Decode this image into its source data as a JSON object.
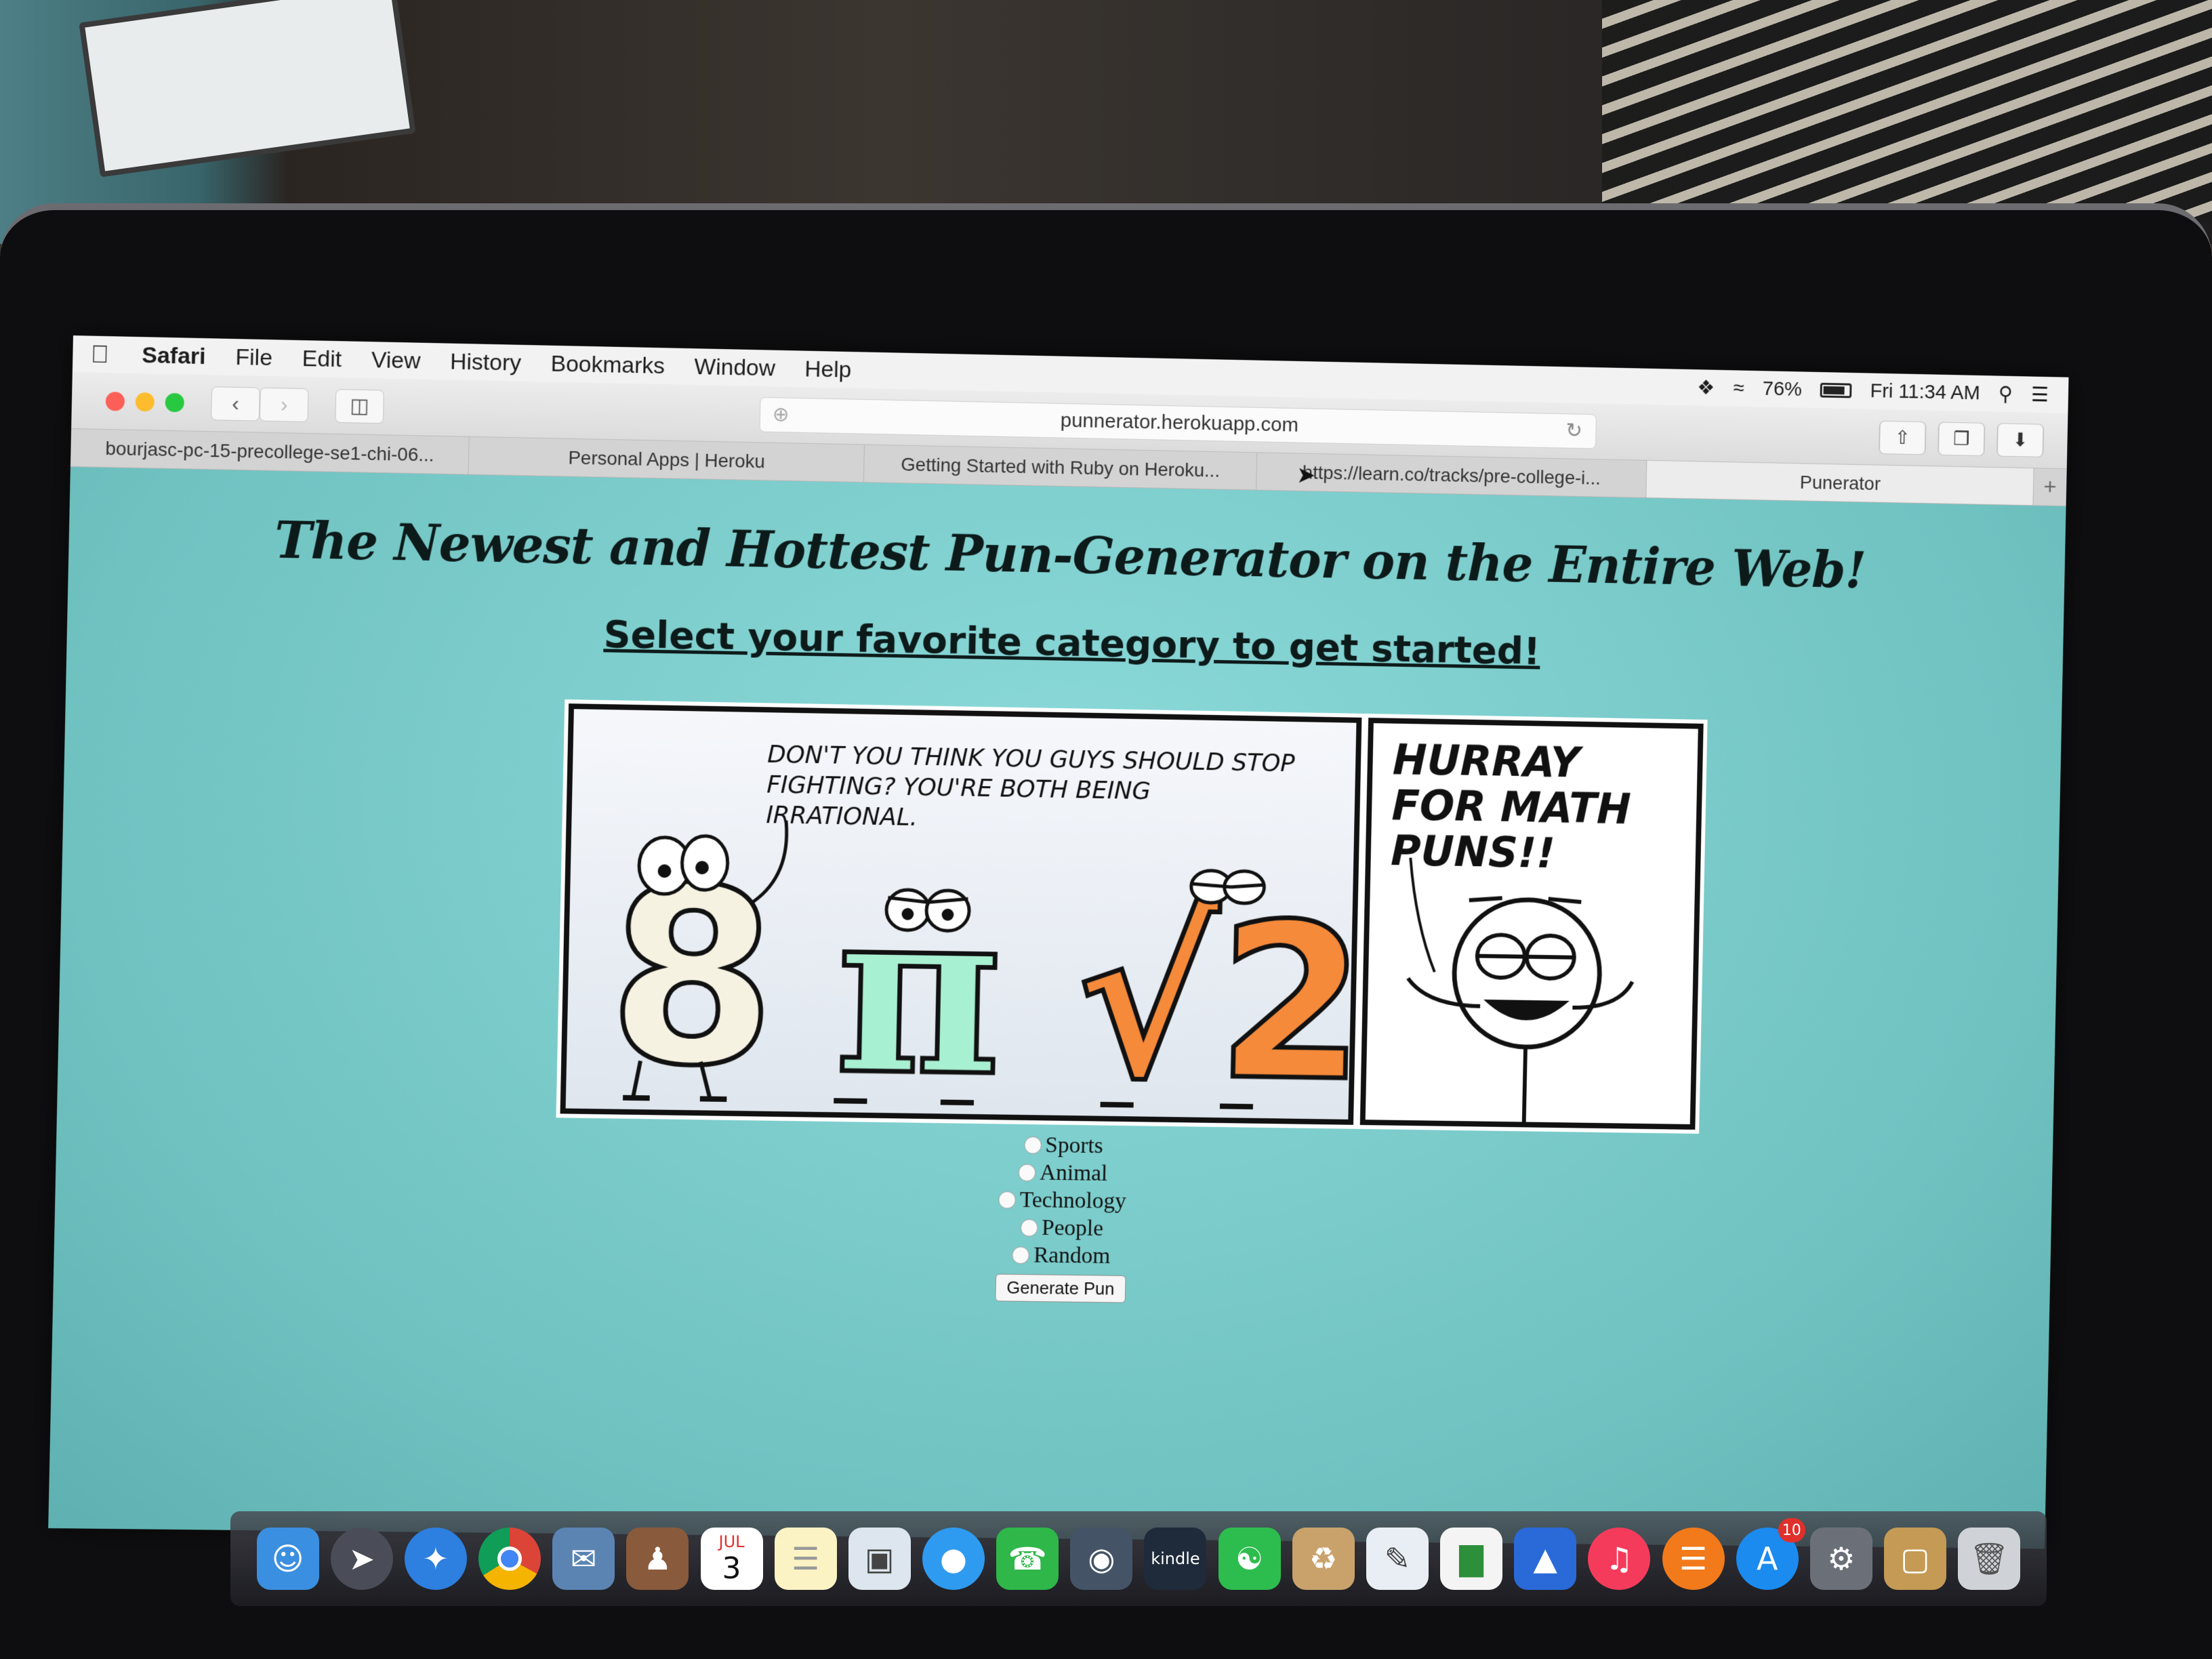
{
  "menubar": {
    "app": "Safari",
    "items": [
      "File",
      "Edit",
      "View",
      "History",
      "Bookmarks",
      "Window",
      "Help"
    ],
    "battery": "76%",
    "clock": "Fri 11:34 AM"
  },
  "toolbar": {
    "url": "punnerator.herokuapp.com"
  },
  "tabs": [
    {
      "label": "bourjasc-pc-15-precollege-se1-chi-06...",
      "active": false
    },
    {
      "label": "Personal Apps | Heroku",
      "active": false
    },
    {
      "label": "Getting Started with Ruby on Heroku...",
      "active": false
    },
    {
      "label": "https://learn.co/tracks/pre-college-i...",
      "active": false
    },
    {
      "label": "Punerator",
      "active": true
    }
  ],
  "page": {
    "headline": "The Newest and Hottest Pun-Generator on the Entire Web!",
    "subhead": "Select your favorite category to get started!",
    "comic": {
      "panel1_text": "DON'T YOU THINK YOU GUYS SHOULD STOP FIGHTING? YOU'RE BOTH BEING IRRATIONAL.",
      "panel2_text": "HURRAY FOR MATH PUNS!!",
      "characters": [
        "8",
        "π",
        "√2"
      ]
    },
    "categories": [
      "Sports",
      "Animal",
      "Technology",
      "People",
      "Random"
    ],
    "generate_button": "Generate Pun"
  },
  "dock": {
    "calendar_month": "JUL",
    "calendar_day": "3",
    "kindle_label": "kindle",
    "app_store_badge": "10"
  },
  "colors": {
    "page_bg": "#7fd0cf",
    "menubar_bg": "#f2f2f2",
    "orange_char": "#f58a3a",
    "mint_char": "#a8f0d2"
  }
}
